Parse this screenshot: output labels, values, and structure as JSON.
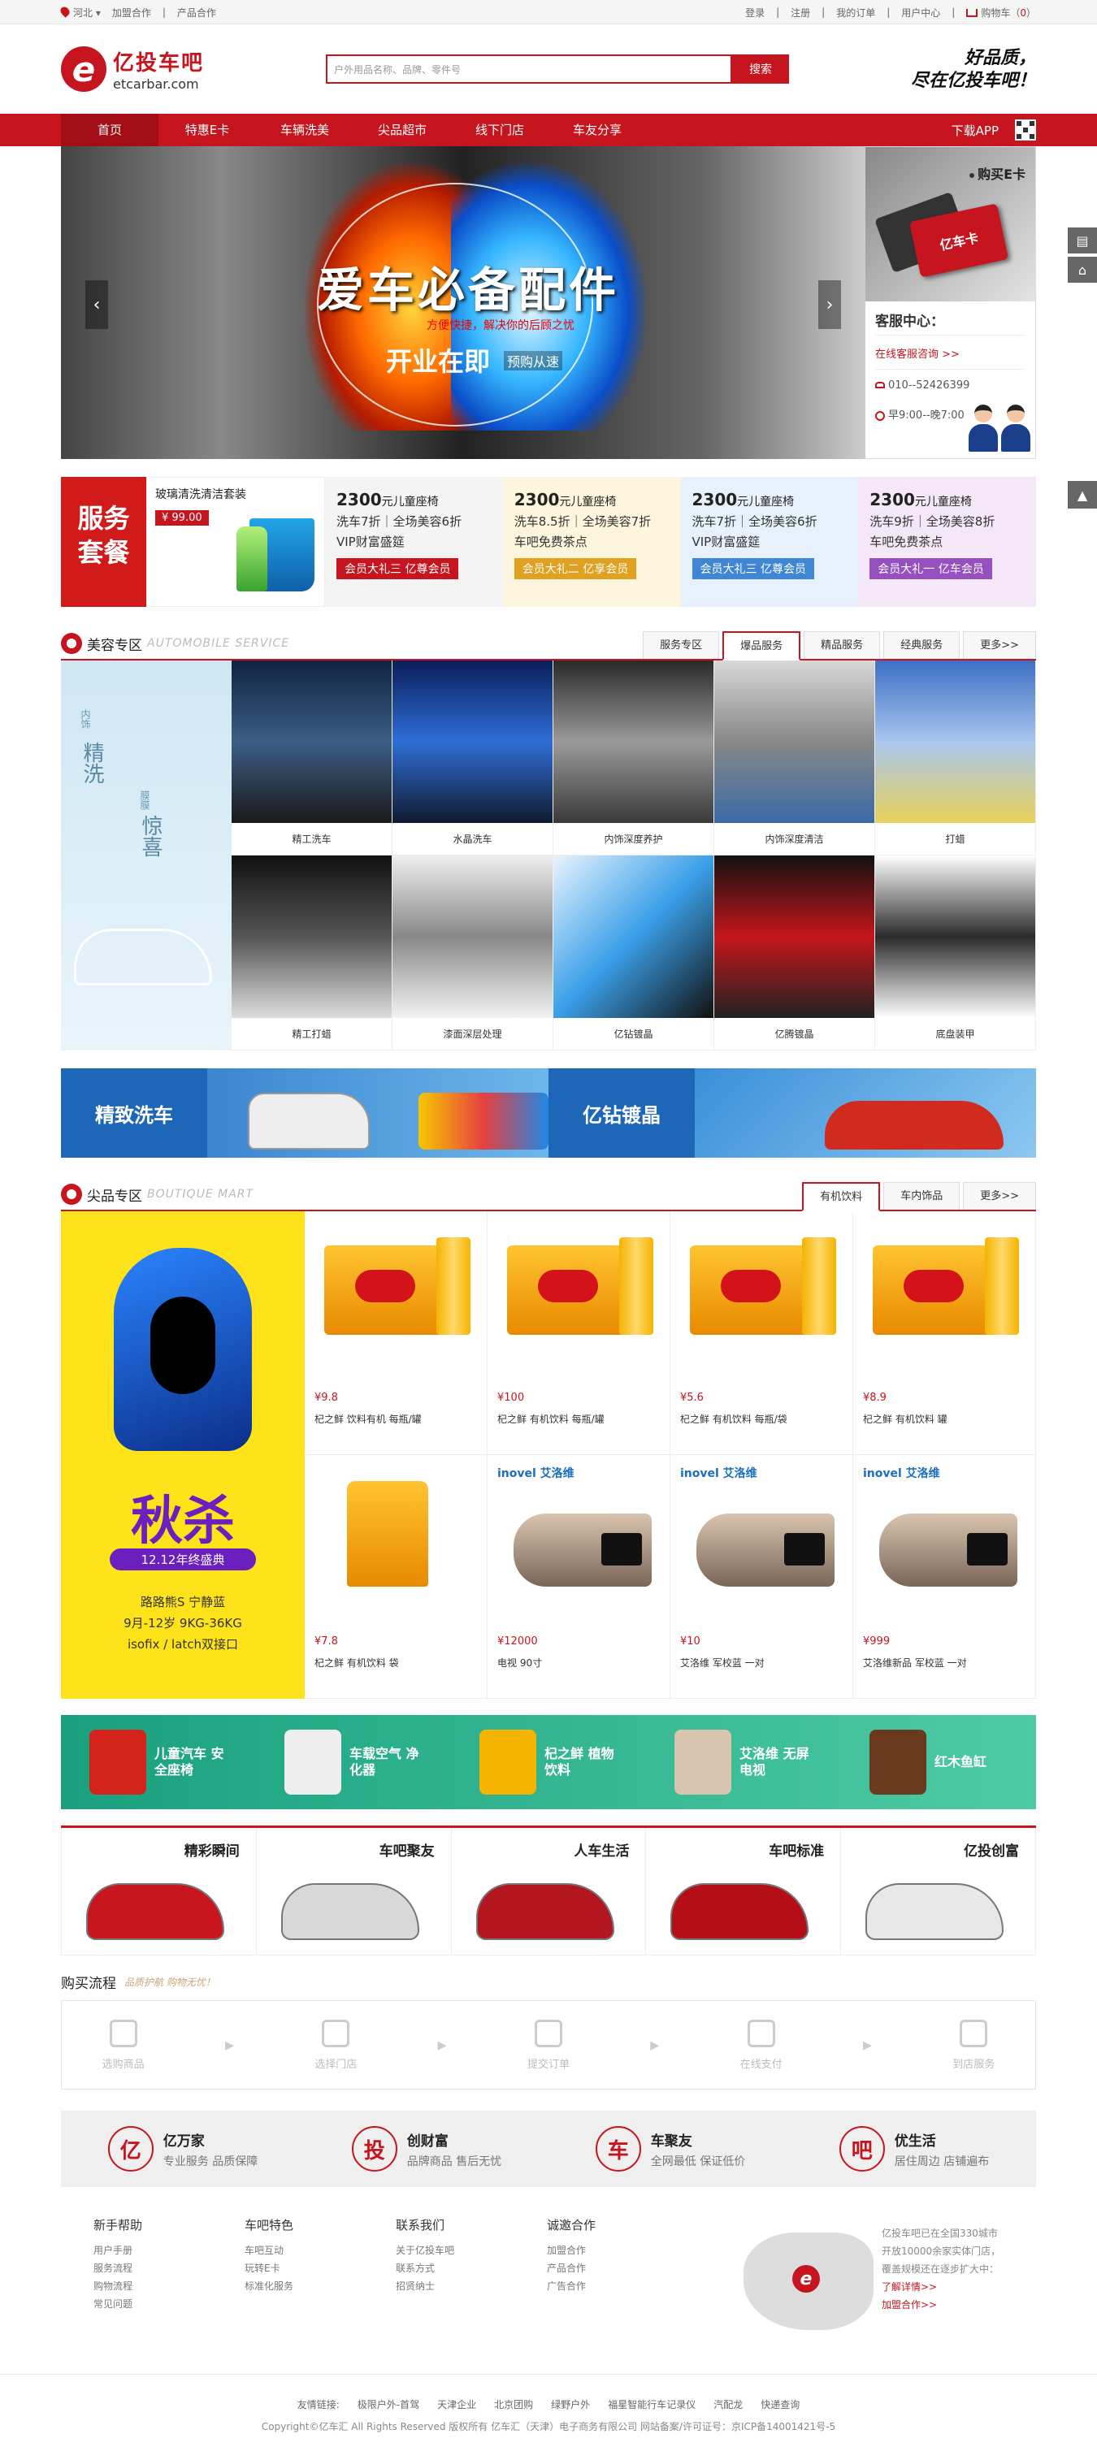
{
  "topbar": {
    "location": "河北",
    "links_left": [
      "加盟合作",
      "产品合作"
    ],
    "links_right": [
      "登录",
      "注册",
      "我的订单",
      "用户中心"
    ],
    "cart_label": "购物车",
    "cart_count": "0"
  },
  "header": {
    "logo_letter": "e",
    "logo_name": "亿投车吧",
    "logo_domain": "etcarbar.com",
    "search_placeholder": "户外用品名称、品牌、零件号",
    "search_button": "搜索",
    "slogan_line1": "好品质，",
    "slogan_line2": "尽在亿投车吧！"
  },
  "nav": {
    "items": [
      "首页",
      "特惠E卡",
      "车辆洗美",
      "尖品超市",
      "线下门店",
      "车友分享"
    ],
    "app": "下载APP"
  },
  "banner": {
    "title": "爱车必备配件",
    "subtitle": "方便快捷，解决你的后顾之忧",
    "open": "开业在即",
    "preorder": "预购从速",
    "buy_card": "购买E卡",
    "card_label": "亿车卡",
    "cs_title": "客服中心：",
    "cs_online": "在线客服咨询 >>",
    "cs_phone": "010--52426399",
    "cs_hours": "早9:00--晚7:00",
    "prev": "‹",
    "next": "›"
  },
  "promo": {
    "service_label": "服务套餐",
    "product_name": "玻璃清洗清洁套装",
    "product_price": "¥ 99.00",
    "deals": [
      {
        "price": "2300",
        "unit": "元",
        "item": "儿童座椅",
        "l1": "洗车7折｜全场美容6折",
        "l2": "VIP财富盛筵",
        "tag": "会员大礼三 亿尊会员",
        "bg": "#f4f4f4",
        "tagc": "#c6151e"
      },
      {
        "price": "2300",
        "unit": "元",
        "item": "儿童座椅",
        "l1": "洗车8.5折｜全场美容7折",
        "l2": "车吧免费茶点",
        "tag": "会员大礼二 亿享会员",
        "bg": "#fdf5dd",
        "tagc": "#e0a020"
      },
      {
        "price": "2300",
        "unit": "元",
        "item": "儿童座椅",
        "l1": "洗车7折｜全场美容6折",
        "l2": "VIP财富盛筵",
        "tag": "会员大礼三 亿尊会员",
        "bg": "#e6f1fb",
        "tagc": "#3f87d4"
      },
      {
        "price": "2300",
        "unit": "元",
        "item": "儿童座椅",
        "l1": "洗车9折｜全场美容8折",
        "l2": "车吧免费茶点",
        "tag": "会员大礼一 亿车会员",
        "bg": "#f4e8f8",
        "tagc": "#9650c0"
      }
    ]
  },
  "beauty": {
    "title": "美容专区",
    "title_en": "AUTOMOBILE SERVICE",
    "tabs": [
      "服务专区",
      "爆品服务",
      "精品服务",
      "经典服务",
      "更多>>"
    ],
    "active_tab": 1,
    "side_small1": "内饰",
    "side_big1": "精洗",
    "side_small2": "膜膜",
    "side_big2": "惊喜",
    "items": [
      {
        "label": "精工洗车",
        "color": "linear-gradient(180deg,#0f2540,#3c5d85,#1a1a1a)"
      },
      {
        "label": "水晶洗车",
        "color": "linear-gradient(180deg,#0a1e5a,#2f6ed6,#101a30)"
      },
      {
        "label": "内饰深度养护",
        "color": "linear-gradient(180deg,#2a2a2a,#9a9a9a,#3a3a3a)"
      },
      {
        "label": "内饰深度清洁",
        "color": "linear-gradient(180deg,#d8d8d8,#888,#3a6aa5)"
      },
      {
        "label": "打蜡",
        "color": "linear-gradient(180deg,#3c6fc4,#a9c6ee,#e8d05a)"
      },
      {
        "label": "精工打蜡",
        "color": "linear-gradient(180deg,#111,#555,#ddd)"
      },
      {
        "label": "漆面深层处理",
        "color": "linear-gradient(180deg,#eee,#888,#f3f3f3)"
      },
      {
        "label": "亿钻镀晶",
        "color": "linear-gradient(135deg,#e8f4ff,#3aa0e8,#111)"
      },
      {
        "label": "亿腾镀晶",
        "color": "linear-gradient(180deg,#111,#c4161c,#222)"
      },
      {
        "label": "底盘装甲",
        "color": "linear-gradient(180deg,#ffffff,#2a2a2a,#ffffff)"
      }
    ]
  },
  "wide_banner": {
    "left": "精致洗车",
    "right": "亿钻镀晶"
  },
  "boutique": {
    "title": "尖品专区",
    "title_en": "BOUTIQUE MART",
    "tabs": [
      "有机饮料",
      "车内饰品",
      "更多>>"
    ],
    "active_tab": 0,
    "side_sale": "秋杀",
    "side_fest": "12.12年终盛典",
    "side_l1": "路路熊S  宁静蓝",
    "side_l2": "9月-12岁 9KG-36KG",
    "side_l3": "isofix / latch双接口",
    "products": [
      {
        "price": "¥9.8",
        "name": "杞之鲜 饮料有机 每瓶/罐",
        "kind": "box"
      },
      {
        "price": "¥100",
        "name": "杞之鲜 有机饮料 每瓶/罐",
        "kind": "box"
      },
      {
        "price": "¥5.6",
        "name": "杞之鲜 有机饮料 每瓶/袋",
        "kind": "box"
      },
      {
        "price": "¥8.9",
        "name": "杞之鲜 有机饮料 罐",
        "kind": "box"
      },
      {
        "price": "¥7.8",
        "name": "杞之鲜 有机饮料 袋",
        "kind": "pouch"
      },
      {
        "price": "¥12000",
        "name": "电视 90寸",
        "kind": "tv"
      },
      {
        "price": "¥10",
        "name": "艾洛维 军校蓝 一对",
        "kind": "tv"
      },
      {
        "price": "¥999",
        "name": "艾洛维新品 军校蓝 一对",
        "kind": "tv"
      }
    ],
    "brand_text": "inovel 艾洛维"
  },
  "green_banner": {
    "items": [
      "儿童汽车 安全座椅",
      "车载空气 净化器",
      "杞之鲜 植物饮料",
      "艾洛维 无屏电视",
      "红木鱼缸"
    ]
  },
  "tiles": {
    "items": [
      "精彩瞬间",
      "车吧聚友",
      "人车生活",
      "车吧标准",
      "亿投创富"
    ]
  },
  "process": {
    "title": "购买流程",
    "slogan": "品质护航 购物无忧！",
    "steps": [
      "选购商品",
      "选择门店",
      "提交订单",
      "在线支付",
      "到店服务"
    ],
    "arrow": "▸"
  },
  "features": {
    "items": [
      {
        "char": "亿",
        "title": "亿万家",
        "desc": "专业服务 品质保障"
      },
      {
        "char": "投",
        "title": "创财富",
        "desc": "品牌商品 售后无忧"
      },
      {
        "char": "车",
        "title": "车聚友",
        "desc": "全网最低 保证低价"
      },
      {
        "char": "吧",
        "title": "优生活",
        "desc": "居住周边 店铺遍布"
      }
    ]
  },
  "footer": {
    "cols": [
      {
        "title": "新手帮助",
        "links": [
          "用户手册",
          "服务流程",
          "购物流程",
          "常见问题"
        ]
      },
      {
        "title": "车吧特色",
        "links": [
          "车吧互动",
          "玩转E卡",
          "标准化服务"
        ]
      },
      {
        "title": "联系我们",
        "links": [
          "关于亿投车吧",
          "联系方式",
          "招贤纳士"
        ]
      },
      {
        "title": "诚邀合作",
        "links": [
          "加盟合作",
          "产品合作",
          "广告合作"
        ]
      }
    ],
    "map_letter": "e",
    "map_l1": "亿投车吧已在全国330城市",
    "map_l2": "开放10000余家实体门店，",
    "map_l3": "覆盖规模还在逐步扩大中：",
    "map_more": "了解详情>>",
    "map_join": "加盟合作>>"
  },
  "bottom": {
    "label": "友情链接:",
    "links": [
      "极限户外-首驾",
      "天津企业",
      "北京团购",
      "绿野户外",
      "福星智能行车记录仪",
      "汽配龙",
      "快递查询"
    ],
    "copyright": "Copyright©亿车汇 All Rights Reserved 版权所有 亿车汇（天津）电子商务有限公司 网站备案/许可证号：京ICP备14001421号-5"
  },
  "colors": {
    "brand": "#c6151e"
  }
}
